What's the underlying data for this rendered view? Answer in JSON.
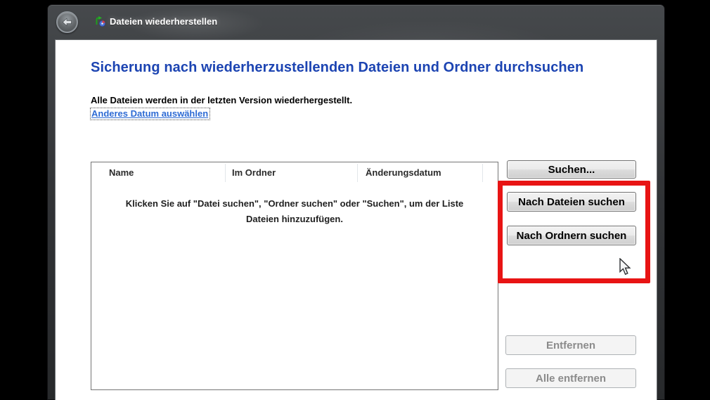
{
  "window": {
    "title": "Dateien wiederherstellen",
    "heading": "Sicherung nach wiederherzustellenden Dateien und Ordner durchsuchen",
    "subtitle": "Alle Dateien werden in der letzten Version wiederhergestellt.",
    "link_label": "Anderes Datum auswählen"
  },
  "list": {
    "columns": [
      "Name",
      "Im Ordner",
      "Änderungsdatum"
    ],
    "empty_line1": "Klicken Sie auf \"Datei suchen\", \"Ordner suchen\" oder \"Suchen\", um der Liste",
    "empty_line2": "Dateien hinzuzufügen."
  },
  "buttons": {
    "search": "Suchen...",
    "search_files": "Nach Dateien suchen",
    "search_folders": "Nach Ordnern suchen",
    "remove": "Entfernen",
    "remove_all": "Alle entfernen"
  },
  "icons": {
    "back": "back-arrow-icon",
    "app": "restore-files-icon",
    "cursor": "mouse-arrow-cursor"
  },
  "colors": {
    "heading_blue": "#1c44b2",
    "link_blue": "#2e6bd4",
    "annotation_red": "#e81414",
    "titlebar_dark": "#323437",
    "client_white": "#ffffff"
  }
}
